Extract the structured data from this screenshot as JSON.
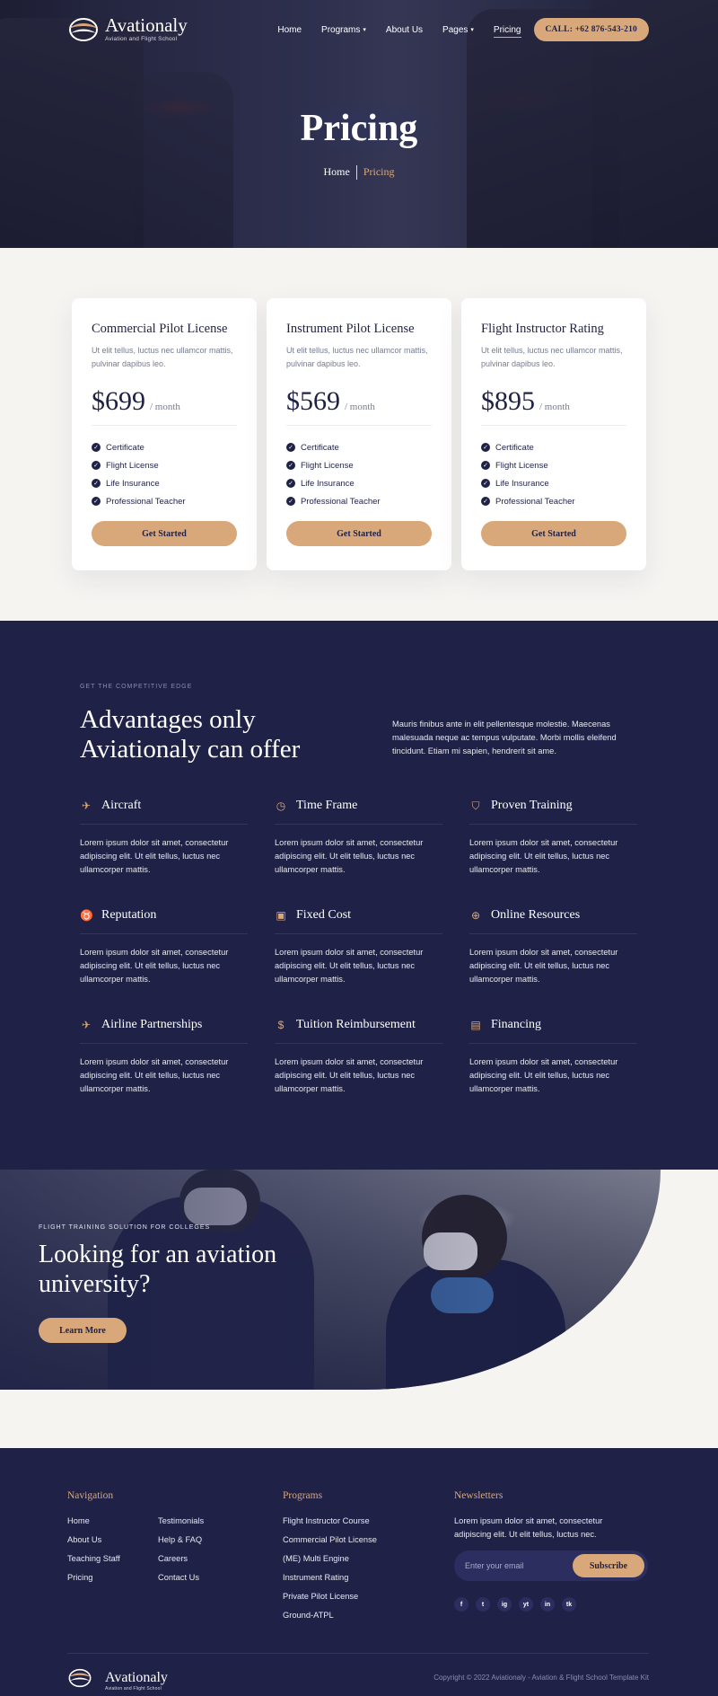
{
  "brand": {
    "name": "Avationaly",
    "tagline": "Aviation and Flight School"
  },
  "nav": {
    "items": [
      {
        "label": "Home"
      },
      {
        "label": "Programs"
      },
      {
        "label": "About Us"
      },
      {
        "label": "Pages"
      },
      {
        "label": "Pricing"
      }
    ],
    "call_label": "CALL: +62 876-543-210"
  },
  "hero": {
    "title": "Pricing",
    "breadcrumb_home": "Home",
    "breadcrumb_current": "Pricing"
  },
  "pricing": {
    "plans": [
      {
        "title": "Commercial Pilot License",
        "desc": "Ut elit tellus, luctus nec ullamcor mattis, pulvinar dapibus leo.",
        "price": "$699",
        "period": "/ month",
        "features": [
          "Certificate",
          "Flight License",
          "Life Insurance",
          "Professional Teacher"
        ],
        "cta": "Get Started"
      },
      {
        "title": "Instrument Pilot License",
        "desc": "Ut elit tellus, luctus nec ullamcor mattis, pulvinar dapibus leo.",
        "price": "$569",
        "period": "/ month",
        "features": [
          "Certificate",
          "Flight License",
          "Life Insurance",
          "Professional Teacher"
        ],
        "cta": "Get Started"
      },
      {
        "title": "Flight Instructor Rating",
        "desc": "Ut elit tellus, luctus nec ullamcor mattis, pulvinar dapibus leo.",
        "price": "$895",
        "period": "/ month",
        "features": [
          "Certificate",
          "Flight License",
          "Life Insurance",
          "Professional Teacher"
        ],
        "cta": "Get Started"
      }
    ]
  },
  "advantages": {
    "eyebrow": "GET THE COMPETITIVE EDGE",
    "title_line1": "Advantages only",
    "title_line2": "Aviationaly can offer",
    "intro": "Mauris finibus ante in elit pellentesque molestie. Maecenas malesuada neque ac tempus vulputate. Morbi mollis eleifend tincidunt. Etiam mi sapien, hendrerit sit ame.",
    "items": [
      {
        "title": "Aircraft",
        "icon": "plane-icon",
        "desc": "Lorem ipsum dolor sit amet, consectetur adipiscing elit. Ut elit tellus, luctus nec ullamcorper mattis."
      },
      {
        "title": "Time Frame",
        "icon": "clock-icon",
        "desc": "Lorem ipsum dolor sit amet, consectetur adipiscing elit. Ut elit tellus, luctus nec ullamcorper mattis."
      },
      {
        "title": "Proven Training",
        "icon": "shield-icon",
        "desc": "Lorem ipsum dolor sit amet, consectetur adipiscing elit. Ut elit tellus, luctus nec ullamcorper mattis."
      },
      {
        "title": "Reputation",
        "icon": "medal-icon",
        "desc": "Lorem ipsum dolor sit amet, consectetur adipiscing elit. Ut elit tellus, luctus nec ullamcorper mattis."
      },
      {
        "title": "Fixed Cost",
        "icon": "money-icon",
        "desc": "Lorem ipsum dolor sit amet, consectetur adipiscing elit. Ut elit tellus, luctus nec ullamcorper mattis."
      },
      {
        "title": "Online Resources",
        "icon": "globe-icon",
        "desc": "Lorem ipsum dolor sit amet, consectetur adipiscing elit. Ut elit tellus, luctus nec ullamcorper mattis."
      },
      {
        "title": "Airline Partnerships",
        "icon": "plane-departure-icon",
        "desc": "Lorem ipsum dolor sit amet, consectetur adipiscing elit. Ut elit tellus, luctus nec ullamcorper mattis."
      },
      {
        "title": "Tuition Reimbursement",
        "icon": "dollar-icon",
        "desc": "Lorem ipsum dolor sit amet, consectetur adipiscing elit. Ut elit tellus, luctus nec ullamcorper mattis."
      },
      {
        "title": "Financing",
        "icon": "invoice-icon",
        "desc": "Lorem ipsum dolor sit amet, consectetur adipiscing elit. Ut elit tellus, luctus nec ullamcorper mattis."
      }
    ]
  },
  "cta": {
    "eyebrow": "FLIGHT TRAINING SOLUTION FOR COLLEGES",
    "title": "Looking for an aviation university?",
    "button": "Learn More"
  },
  "footer": {
    "navigation_heading": "Navigation",
    "navigation_col1": [
      "Home",
      "About Us",
      "Teaching Staff",
      "Pricing"
    ],
    "navigation_col2": [
      "Testimonials",
      "Help & FAQ",
      "Careers",
      "Contact Us"
    ],
    "programs_heading": "Programs",
    "programs": [
      "Flight Instructor Course",
      "Commercial Pilot License",
      "(ME) Multi Engine",
      "Instrument Rating",
      "Private Pilot License",
      "Ground-ATPL"
    ],
    "newsletter_heading": "Newsletters",
    "newsletter_text": "Lorem ipsum dolor sit amet, consectetur adipiscing elit. Ut elit tellus, luctus nec.",
    "email_placeholder": "Enter your email",
    "subscribe_label": "Subscribe",
    "socials": [
      "f",
      "t",
      "ig",
      "yt",
      "in",
      "tk"
    ],
    "copyright": "Copyright © 2022 Aviationaly - Aviation & Flight School Template Kit"
  },
  "colors": {
    "navy": "#1f2147",
    "accent": "#d9a87a",
    "background": "#f6f4f1"
  }
}
